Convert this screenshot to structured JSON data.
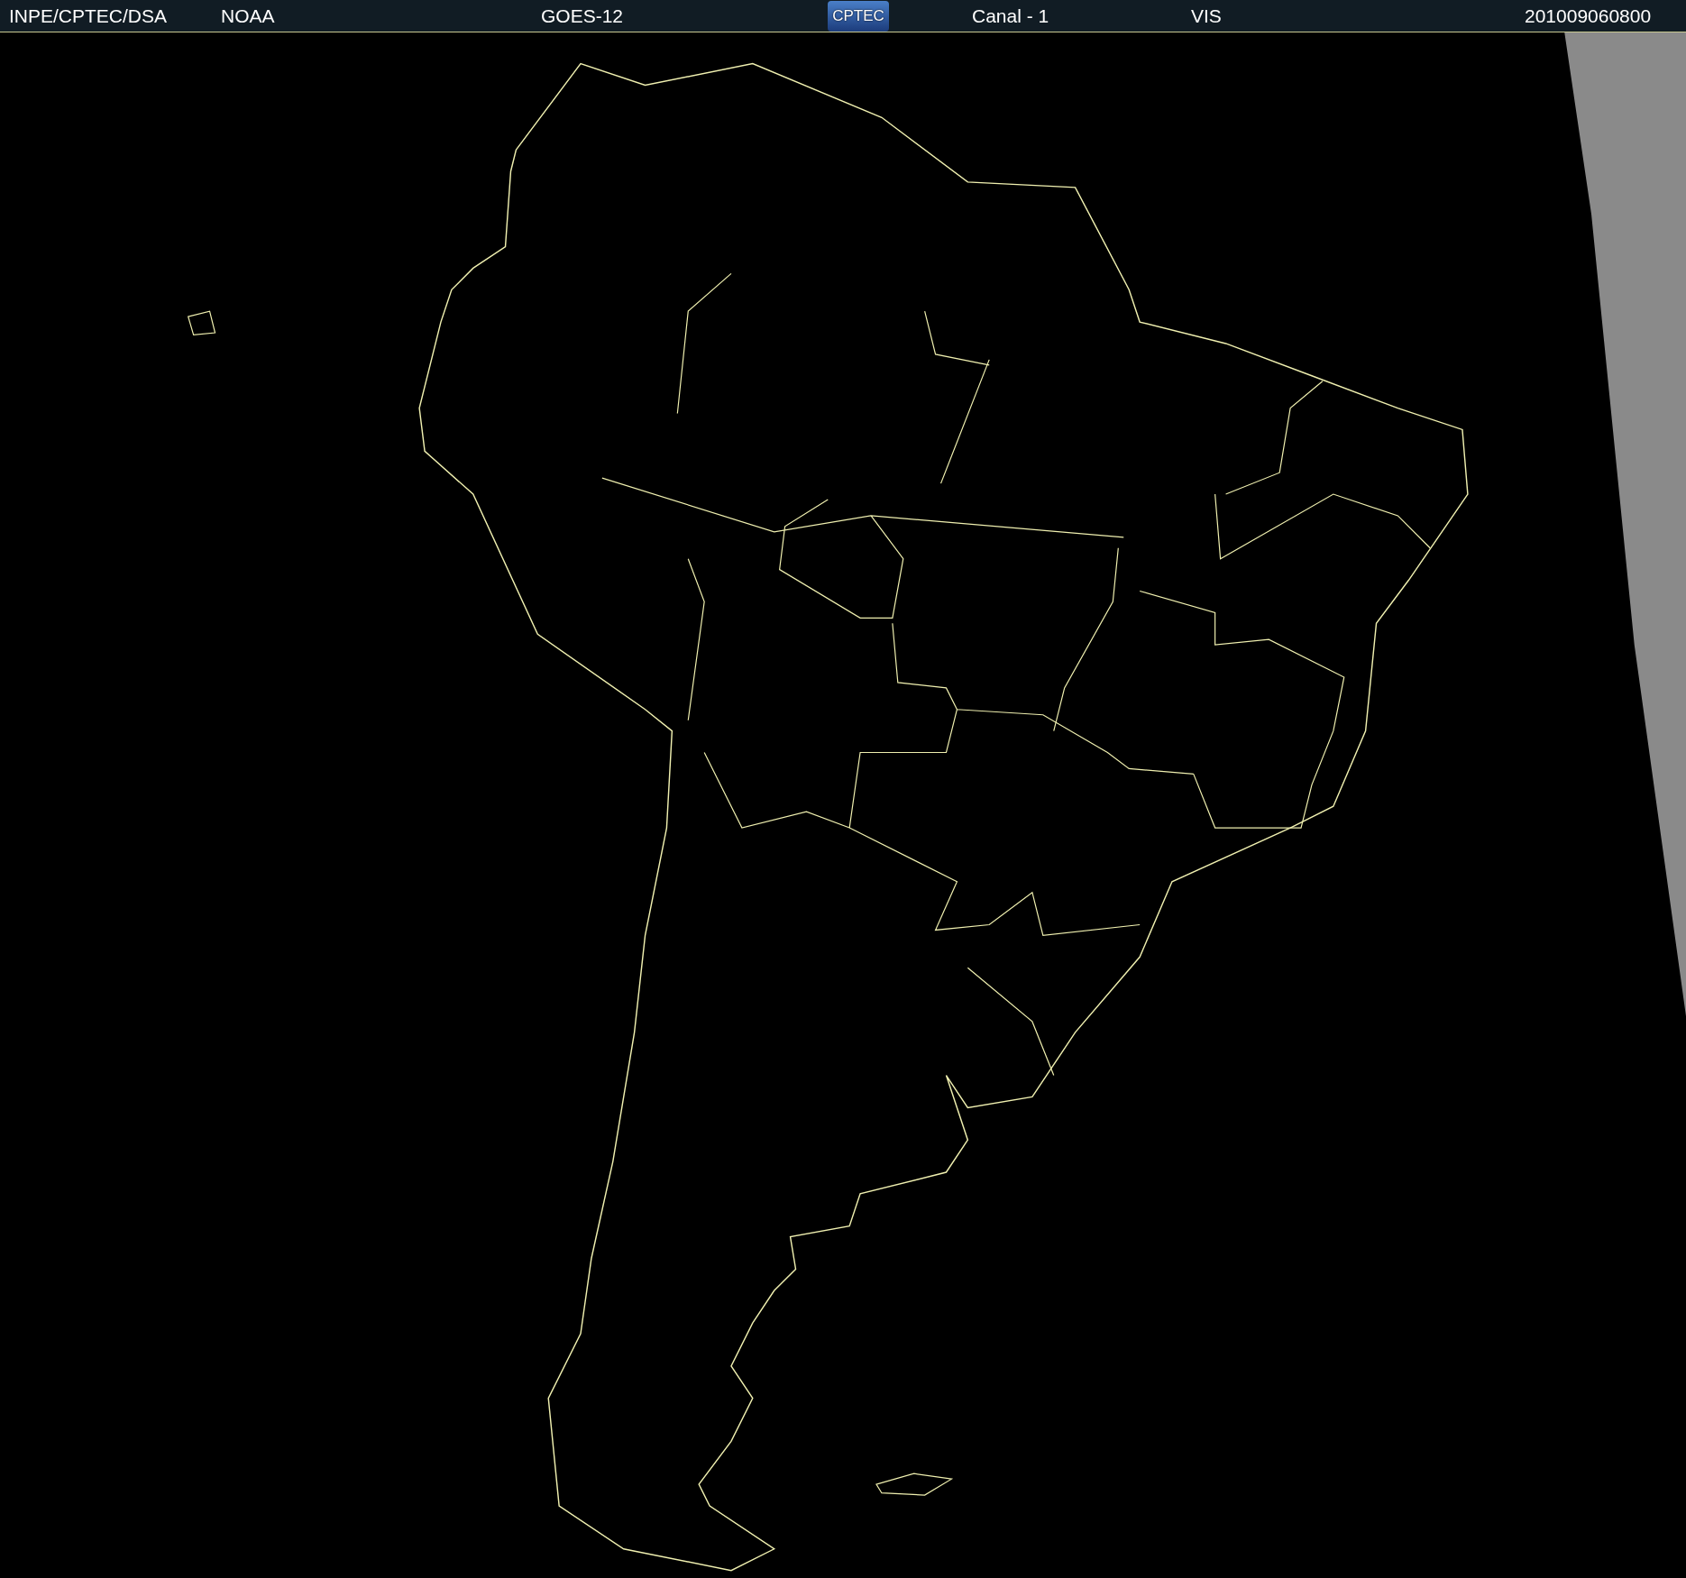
{
  "header": {
    "items": [
      {
        "kind": "text",
        "text": "INPE/CPTEC/DSA"
      },
      {
        "kind": "text",
        "text": "NOAA"
      },
      {
        "kind": "text",
        "text": "GOES-12"
      },
      {
        "kind": "logo",
        "text": "CPTEC"
      },
      {
        "kind": "text",
        "text": "Canal - 1"
      },
      {
        "kind": "text",
        "text": "VIS"
      },
      {
        "kind": "text",
        "text": "201009060800"
      }
    ]
  }
}
